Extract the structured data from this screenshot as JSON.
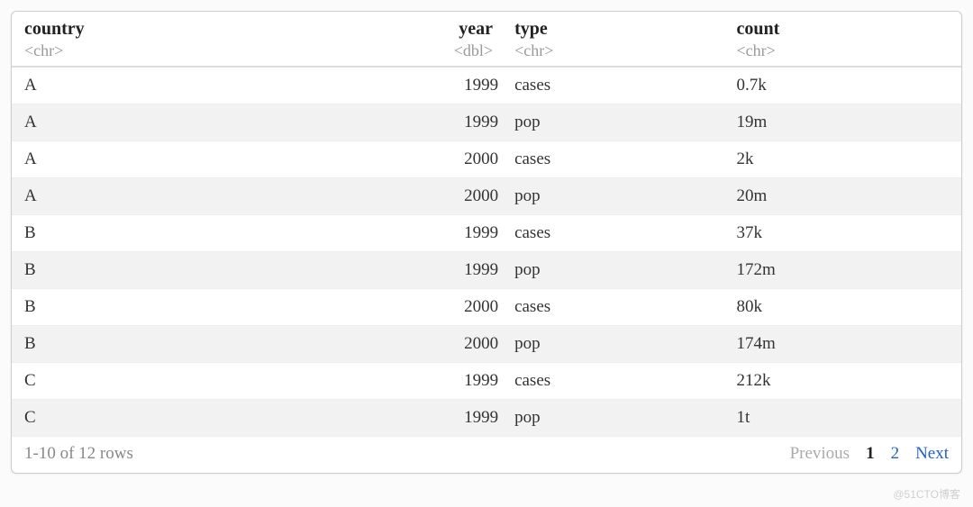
{
  "columns": [
    {
      "name": "country",
      "type": "<chr>",
      "class": "col-country"
    },
    {
      "name": "year",
      "type": "<dbl>",
      "class": "col-year"
    },
    {
      "name": "type",
      "type": "<chr>",
      "class": "col-type"
    },
    {
      "name": "count",
      "type": "<chr>",
      "class": "col-count"
    }
  ],
  "rows": [
    {
      "country": "A",
      "year": "1999",
      "type": "cases",
      "count": "0.7k"
    },
    {
      "country": "A",
      "year": "1999",
      "type": "pop",
      "count": "19m"
    },
    {
      "country": "A",
      "year": "2000",
      "type": "cases",
      "count": "2k"
    },
    {
      "country": "A",
      "year": "2000",
      "type": "pop",
      "count": "20m"
    },
    {
      "country": "B",
      "year": "1999",
      "type": "cases",
      "count": "37k"
    },
    {
      "country": "B",
      "year": "1999",
      "type": "pop",
      "count": "172m"
    },
    {
      "country": "B",
      "year": "2000",
      "type": "cases",
      "count": "80k"
    },
    {
      "country": "B",
      "year": "2000",
      "type": "pop",
      "count": "174m"
    },
    {
      "country": "C",
      "year": "1999",
      "type": "cases",
      "count": "212k"
    },
    {
      "country": "C",
      "year": "1999",
      "type": "pop",
      "count": "1t"
    }
  ],
  "footer": {
    "summary": "1-10 of 12 rows",
    "previous": "Previous",
    "current_page": "1",
    "other_page": "2",
    "next": "Next"
  },
  "watermark": "@51CTO博客"
}
